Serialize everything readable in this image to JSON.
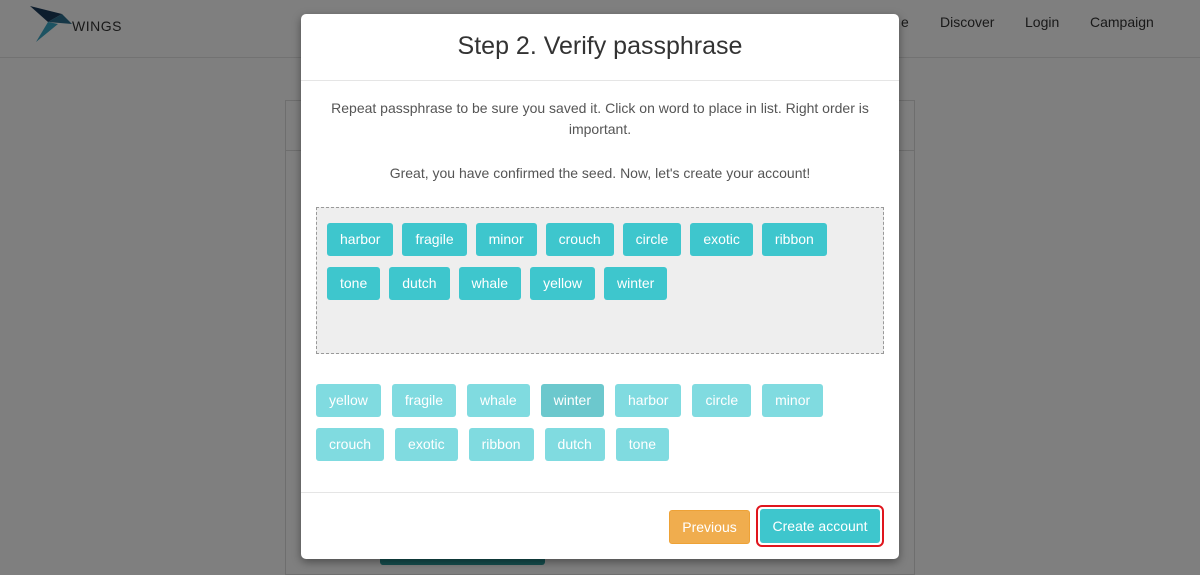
{
  "nav": {
    "logo_text": "WINGS",
    "partial_item": "e",
    "items": [
      "Discover",
      "Login",
      "Campaign"
    ]
  },
  "modal": {
    "title": "Step 2. Verify passphrase",
    "instructions": "Repeat passphrase to be sure you saved it. Click on word to place in list. Right order is important.",
    "success": "Great, you have confirmed the seed. Now, let's create your account!",
    "selected_words": {
      "row1": [
        "harbor",
        "fragile",
        "minor",
        "crouch",
        "circle",
        "exotic",
        "ribbon"
      ],
      "row2": [
        "tone",
        "dutch",
        "whale",
        "yellow",
        "winter"
      ]
    },
    "pool_words": {
      "row1": [
        "yellow",
        "fragile",
        "whale",
        "winter",
        "harbor",
        "circle",
        "minor"
      ],
      "row2": [
        "crouch",
        "exotic",
        "ribbon",
        "dutch",
        "tone"
      ]
    },
    "previous_label": "Previous",
    "create_label": "Create account"
  },
  "colors": {
    "accent": "#3ec6cd",
    "warning": "#f0ad4e",
    "highlight": "#e0151d"
  },
  "icons": {
    "logo": "bird-logo-icon"
  }
}
